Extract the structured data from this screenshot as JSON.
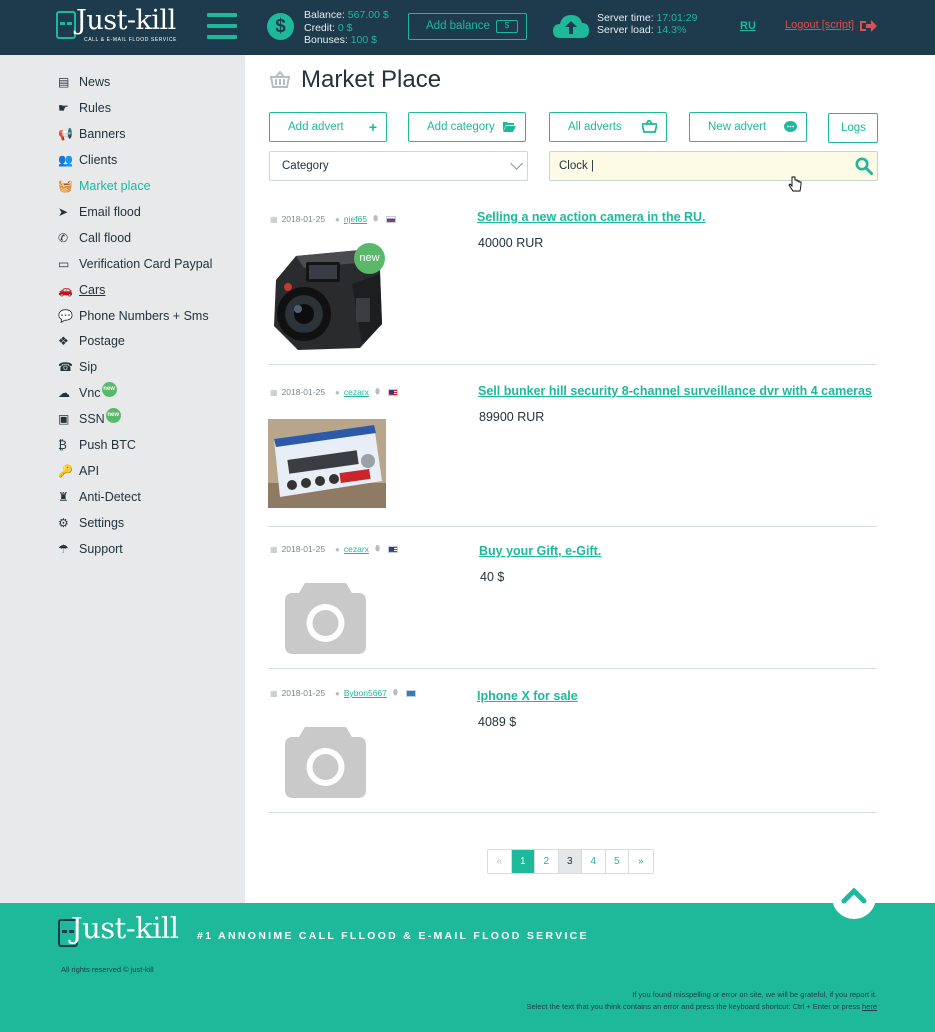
{
  "header": {
    "logo_text": "Just-kill",
    "logo_sub": "CALL & E-MAIL FLOOD SERVICE",
    "balance_label": "Balance:",
    "balance_value": "567.00 $",
    "credit_label": "Credit:",
    "credit_value": "0 $",
    "bonuses_label": "Bonuses:",
    "bonuses_value": "100 $",
    "add_balance": "Add balance",
    "add_balance_icon": "$",
    "server_time_label": "Server time:",
    "server_time_value": "17:01:29",
    "server_load_label": "Server load:",
    "server_load_value": "14.3%",
    "lang": "RU",
    "logout": "Logout [script]"
  },
  "sidebar": {
    "items": [
      {
        "label": "News",
        "icon": "▤"
      },
      {
        "label": "Rules",
        "icon": "☛"
      },
      {
        "label": "Banners",
        "icon": "📢"
      },
      {
        "label": "Clients",
        "icon": "👥"
      },
      {
        "label": "Market place",
        "icon": "🧺"
      },
      {
        "label": "Email flood",
        "icon": "➤"
      },
      {
        "label": "Call flood",
        "icon": "✆"
      },
      {
        "label": "Verification Card Paypal",
        "icon": "▭"
      },
      {
        "label": "Cars",
        "icon": "🚗"
      },
      {
        "label": "Phone Numbers + Sms",
        "icon": "💬"
      },
      {
        "label": "Postage",
        "icon": "❖"
      },
      {
        "label": "Sip",
        "icon": "☎"
      },
      {
        "label": "Vnc",
        "icon": "☁",
        "badge": "new"
      },
      {
        "label": "SSN",
        "icon": "▣",
        "badge": "new"
      },
      {
        "label": "Push BTC",
        "icon": "₿"
      },
      {
        "label": "API",
        "icon": "🔑"
      },
      {
        "label": "Anti-Detect",
        "icon": "♜"
      },
      {
        "label": "Settings",
        "icon": "⚙"
      },
      {
        "label": "Support",
        "icon": "☂"
      }
    ]
  },
  "main": {
    "title": "Market Place",
    "buttons": {
      "add_advert": "Add advert",
      "add_category": "Add category",
      "all_adverts": "All adverts",
      "new_advert": "New advert",
      "logs": "Logs"
    },
    "category_select": "Category",
    "search_value": "Clock |",
    "listings": [
      {
        "date": "2018-01-25",
        "user": "njef65",
        "flag": "ru",
        "title": "Selling a new action camera in the RU.",
        "price": "40000 RUR",
        "badge": "new"
      },
      {
        "date": "2018-01-25",
        "user": "cezarx",
        "flag": "us",
        "title": "Sell bunker hill security 8-channel surveillance dvr with 4 cameras",
        "price": "89900 RUR"
      },
      {
        "date": "2018-01-25",
        "user": "cezarx",
        "flag": "us",
        "title": "Buy your Gift, e-Gift.",
        "price": "40 $"
      },
      {
        "date": "2018-01-25",
        "user": "Bybon5667",
        "flag": "other",
        "title": "Iphone X for sale",
        "price": "4089 $"
      }
    ],
    "pagination": [
      "«",
      "1",
      "2",
      "3",
      "4",
      "5",
      "»"
    ]
  },
  "footer": {
    "logo_text": "Just-kill",
    "tagline": "#1 ANNONIME CALL FLLOOD & E-MAIL FLOOD SERVICE",
    "rights": "All rights reserved © just-kill",
    "report_line1": "If you found misspelling or error on site, we will be grateful, if you report it.",
    "report_line2": "Select the text that you think contains an error and press the keyboard shortcut: Ctrl + Enter or press",
    "report_link": "here"
  },
  "colors": {
    "accent": "#1eb89b",
    "header_bg": "#1d3b4c",
    "sidebar_bg": "#e8e9ea",
    "logout": "#e04e4e"
  }
}
